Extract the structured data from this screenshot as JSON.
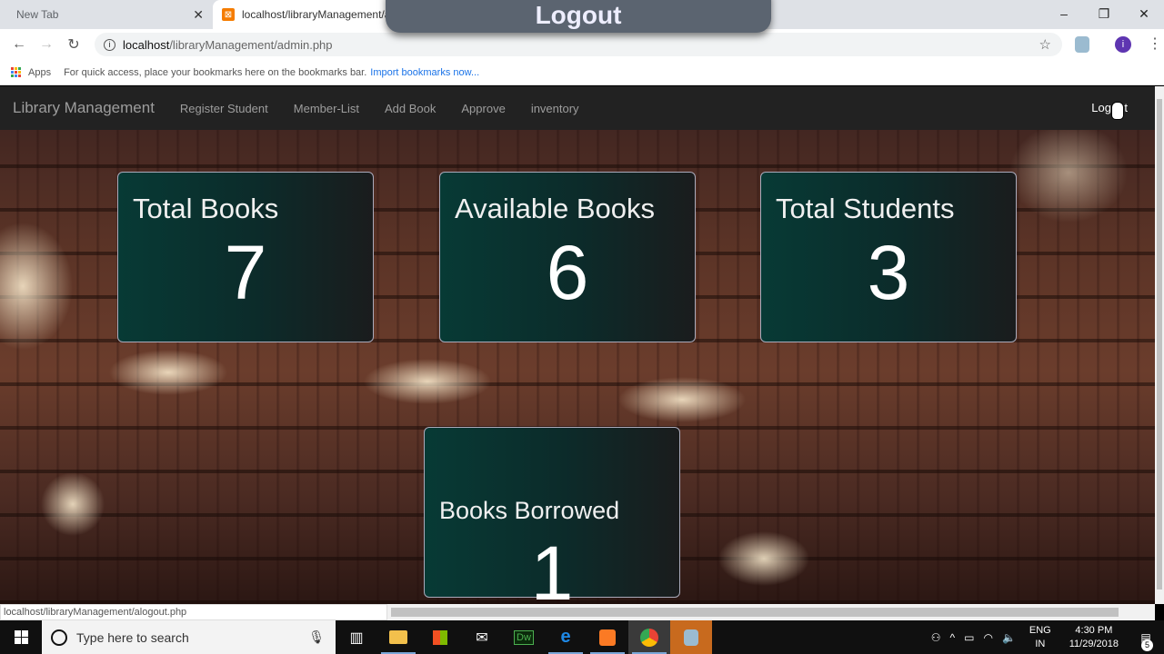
{
  "browser": {
    "tabs": [
      {
        "title": "New Tab",
        "active": false
      },
      {
        "title": "localhost/libraryManagement/a",
        "active": true
      }
    ],
    "url_host": "localhost",
    "url_path": "/libraryManagement/admin.php",
    "bookmarks": {
      "apps_label": "Apps",
      "hint": "For quick access, place your bookmarks here on the bookmarks bar.",
      "import_link": "Import bookmarks now..."
    },
    "profile_initial": "i",
    "status_url": "localhost/libraryManagement/alogout.php"
  },
  "overlay": {
    "caption": "Logout"
  },
  "navbar": {
    "brand": "Library Management",
    "links": [
      "Register Student",
      "Member-List",
      "Add Book",
      "Approve",
      "inventory"
    ],
    "logout": "Logout"
  },
  "stats": [
    {
      "label": "Total Books",
      "value": "7"
    },
    {
      "label": "Available Books",
      "value": "6"
    },
    {
      "label": "Total Students",
      "value": "3"
    },
    {
      "label": "Books Borrowed",
      "value": "1"
    }
  ],
  "taskbar": {
    "search_placeholder": "Type here to search",
    "language": "ENG",
    "region": "IN",
    "time": "4:30 PM",
    "date": "11/29/2018",
    "notification_count": "5"
  },
  "colors": {
    "navbar_bg": "#222222",
    "card_bg": "#073a35",
    "link": "#1a73e8"
  }
}
